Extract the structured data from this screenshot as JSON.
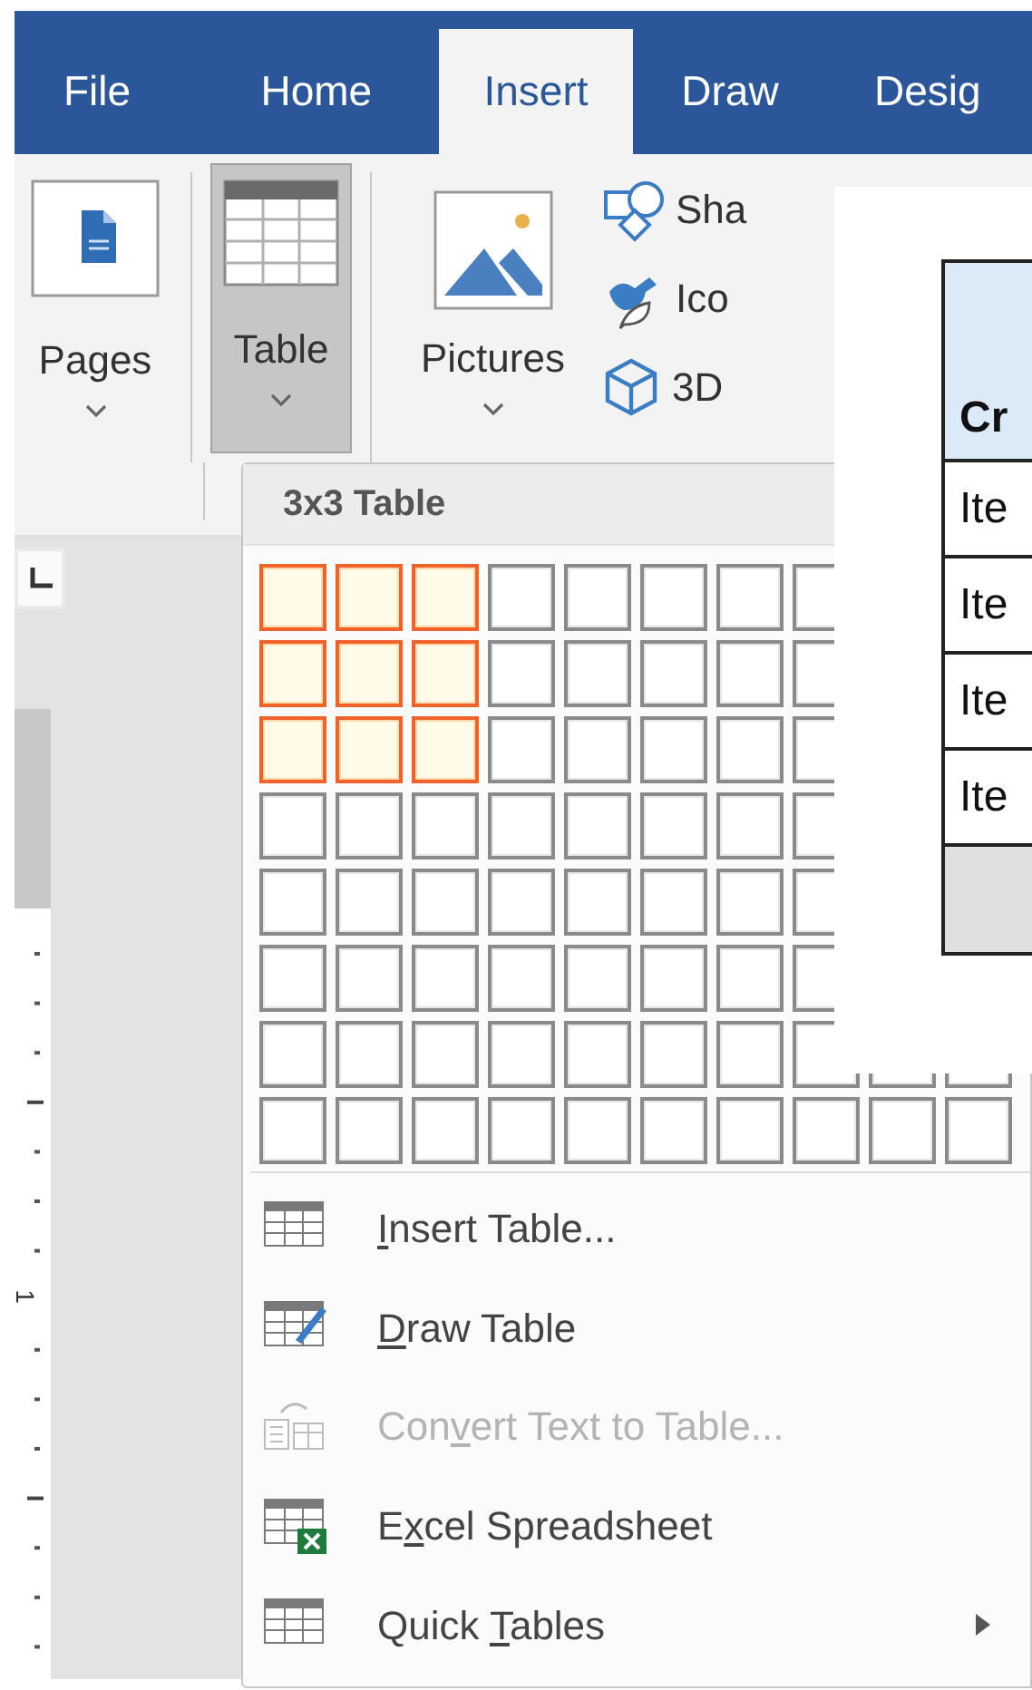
{
  "tabs": [
    {
      "label": "File",
      "selected": false
    },
    {
      "label": "Home",
      "selected": false
    },
    {
      "label": "Insert",
      "selected": true
    },
    {
      "label": "Draw",
      "selected": false
    },
    {
      "label": "Desig",
      "selected": false
    }
  ],
  "ribbon": {
    "large_buttons": [
      {
        "kind": "pages",
        "label": "Pages",
        "pressed": false
      },
      {
        "kind": "table",
        "label": "Table",
        "pressed": true
      },
      {
        "kind": "pictures",
        "label": "Pictures",
        "pressed": false
      }
    ],
    "small_buttons": [
      {
        "kind": "shapes",
        "label": "Sha"
      },
      {
        "kind": "icons",
        "label": "Ico"
      },
      {
        "kind": "cube",
        "label": "3D"
      }
    ]
  },
  "ruler": {
    "number": "1"
  },
  "table_menu": {
    "title": "3x3 Table",
    "grid": [
      {
        "cells": [
          {
            "selected": true
          },
          {
            "selected": true
          },
          {
            "selected": true
          },
          {
            "selected": false
          },
          {
            "selected": false
          },
          {
            "selected": false
          },
          {
            "selected": false
          },
          {
            "selected": false
          }
        ]
      },
      {
        "cells": [
          {
            "selected": true
          },
          {
            "selected": true
          },
          {
            "selected": true
          },
          {
            "selected": false
          },
          {
            "selected": false
          },
          {
            "selected": false
          },
          {
            "selected": false
          },
          {
            "selected": false
          }
        ]
      },
      {
        "cells": [
          {
            "selected": true
          },
          {
            "selected": true
          },
          {
            "selected": true
          },
          {
            "selected": false
          },
          {
            "selected": false
          },
          {
            "selected": false
          },
          {
            "selected": false
          },
          {
            "selected": false
          }
        ]
      },
      {
        "cells": [
          {
            "selected": false
          },
          {
            "selected": false
          },
          {
            "selected": false
          },
          {
            "selected": false
          },
          {
            "selected": false
          },
          {
            "selected": false
          },
          {
            "selected": false
          },
          {
            "selected": false
          }
        ]
      },
      {
        "cells": [
          {
            "selected": false
          },
          {
            "selected": false
          },
          {
            "selected": false
          },
          {
            "selected": false
          },
          {
            "selected": false
          },
          {
            "selected": false
          },
          {
            "selected": false
          },
          {
            "selected": false
          }
        ]
      },
      {
        "cells": [
          {
            "selected": false
          },
          {
            "selected": false
          },
          {
            "selected": false
          },
          {
            "selected": false
          },
          {
            "selected": false
          },
          {
            "selected": false
          },
          {
            "selected": false
          },
          {
            "selected": false
          }
        ]
      },
      {
        "cells": [
          {
            "selected": false
          },
          {
            "selected": false
          },
          {
            "selected": false
          },
          {
            "selected": false
          },
          {
            "selected": false
          },
          {
            "selected": false
          },
          {
            "selected": false
          },
          {
            "selected": false
          },
          {
            "selected": false
          },
          {
            "selected": false
          }
        ]
      },
      {
        "cells": [
          {
            "selected": false
          },
          {
            "selected": false
          },
          {
            "selected": false
          },
          {
            "selected": false
          },
          {
            "selected": false
          },
          {
            "selected": false
          },
          {
            "selected": false
          },
          {
            "selected": false
          },
          {
            "selected": false
          },
          {
            "selected": false
          }
        ]
      }
    ],
    "items": [
      {
        "kind": "insert",
        "access_key": "I",
        "label_end": "nsert Table...",
        "disabled": false,
        "submenu": false
      },
      {
        "kind": "draw",
        "access_key": "D",
        "label_end": "raw Table",
        "disabled": false,
        "submenu": false
      },
      {
        "kind": "convert",
        "label_start": "Con",
        "access_key": "v",
        "label_end": "ert Text to Table...",
        "disabled": true,
        "submenu": false
      },
      {
        "kind": "excel",
        "label_start": "E",
        "access_key": "x",
        "label_end": "cel Spreadsheet",
        "disabled": false,
        "submenu": false
      },
      {
        "kind": "quick",
        "label_start": "Quick ",
        "access_key": "T",
        "label_end": "ables",
        "disabled": false,
        "submenu": true
      }
    ]
  },
  "document_preview": {
    "header": "Cr",
    "rows": [
      "Ite",
      "Ite",
      "Ite",
      "Ite"
    ]
  }
}
